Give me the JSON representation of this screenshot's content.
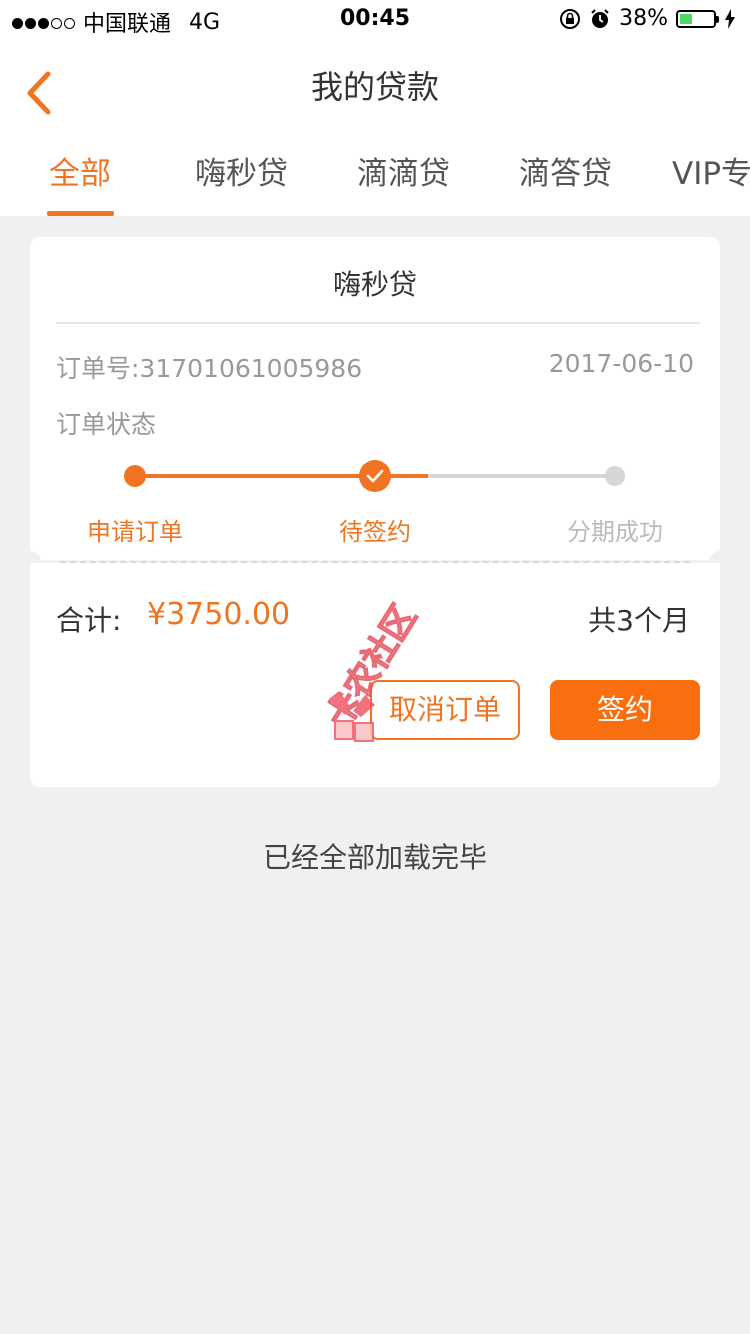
{
  "status_bar": {
    "carrier": "中国联通",
    "network": "4G",
    "time": "00:45",
    "battery": "38%",
    "battery_level": 0.38
  },
  "nav": {
    "title": "我的贷款"
  },
  "tabs": [
    {
      "label": "全部",
      "active": true
    },
    {
      "label": "嗨秒贷",
      "active": false
    },
    {
      "label": "滴滴贷",
      "active": false
    },
    {
      "label": "滴答贷",
      "active": false
    },
    {
      "label": "VIP专",
      "active": false
    }
  ],
  "order": {
    "product_name": "嗨秒贷",
    "order_number": "订单号:31701061005986",
    "date": "2017-06-10",
    "status_label": "订单状态",
    "steps": [
      {
        "label": "申请订单",
        "state": "done"
      },
      {
        "label": "待签约",
        "state": "current"
      },
      {
        "label": "分期成功",
        "state": "pending"
      }
    ],
    "total_label": "合计:",
    "total_amount": "¥3750.00",
    "months": "共3个月",
    "cancel_label": "取消订单",
    "sign_label": "签约"
  },
  "footer": {
    "end_text": "已经全部加载完毕"
  },
  "colors": {
    "accent": "#f07421",
    "button": "#f96f10",
    "background": "#f0f0f0"
  },
  "watermark": {
    "text": "卡农社区"
  }
}
